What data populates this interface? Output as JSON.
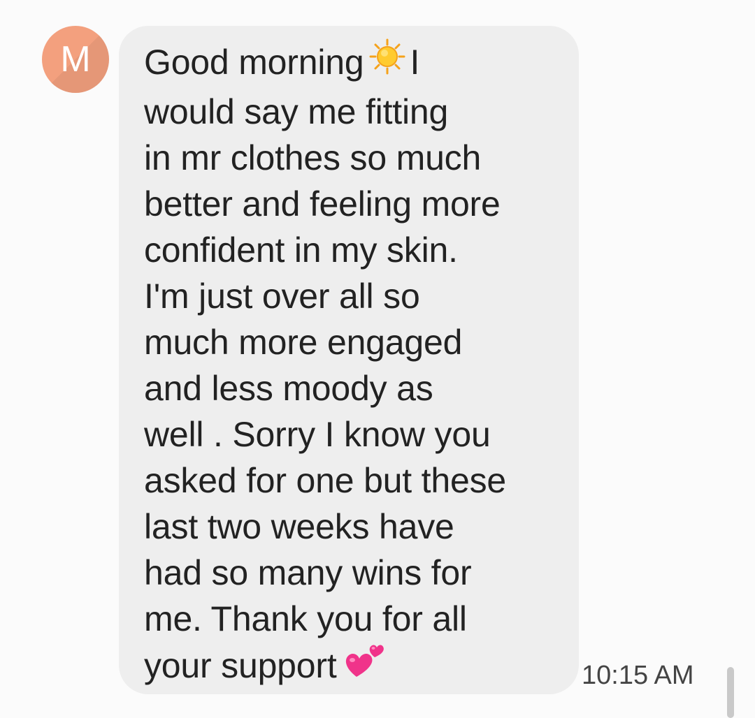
{
  "contact": {
    "avatar_letter": "M",
    "avatar_color": "#f3a07e"
  },
  "message": {
    "lines": [
      "Good morning",
      "I",
      "would say me fitting",
      "in mr clothes so much",
      "better and feeling more",
      "confident in my skin.",
      "I'm just over all so",
      "much more engaged",
      "and less moody as",
      "well . Sorry I know you",
      "asked for one but these",
      "last two weeks have",
      "had so many wins for",
      "me. Thank you for all",
      "your support"
    ],
    "emojis": {
      "sun": "sun-icon",
      "hearts": "two-hearts-icon"
    },
    "timestamp": "10:15 AM",
    "bubble_color": "#eeeeee"
  }
}
